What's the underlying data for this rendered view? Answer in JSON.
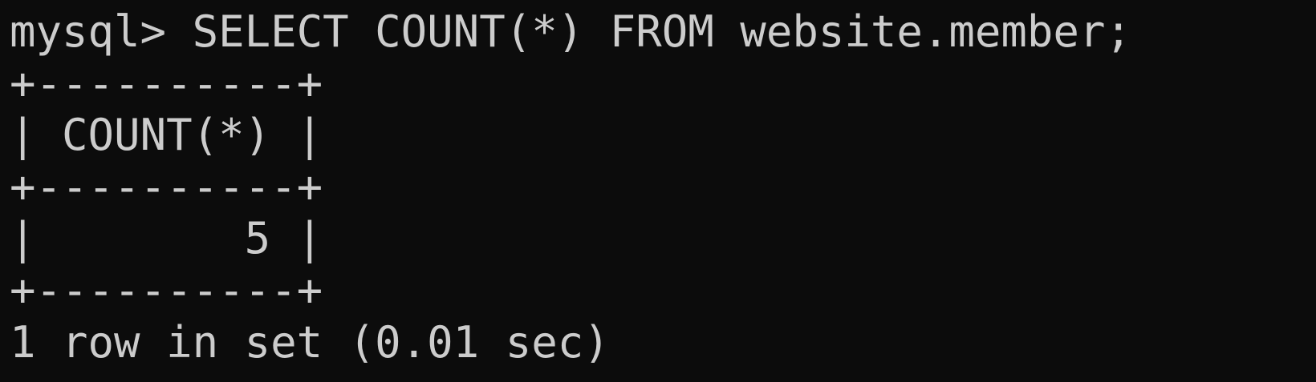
{
  "terminal": {
    "prompt": "mysql> ",
    "command": "SELECT COUNT(*) FROM website.member;",
    "result_table": {
      "border": "+----------+",
      "column_header": "COUNT(*)",
      "rows": [
        "5"
      ]
    },
    "footer": "1 row in set (0.01 sec)"
  }
}
